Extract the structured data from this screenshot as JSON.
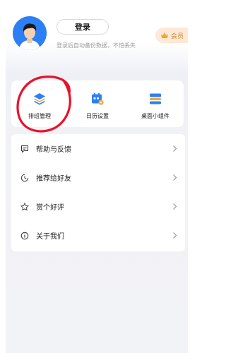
{
  "header": {
    "login_label": "登录",
    "login_hint": "登录后自动备份数据，不怕丢失",
    "vip_label": "会员"
  },
  "tools": [
    {
      "label": "排班管理",
      "icon": "layers-icon"
    },
    {
      "label": "日历设置",
      "icon": "calendar-settings-icon"
    },
    {
      "label": "桌面小组件",
      "icon": "widget-icon"
    }
  ],
  "menu": [
    {
      "label": "帮助与反馈",
      "icon": "feedback-icon"
    },
    {
      "label": "推荐给好友",
      "icon": "recommend-icon"
    },
    {
      "label": "赏个好评",
      "icon": "star-icon"
    },
    {
      "label": "关于我们",
      "icon": "info-icon"
    }
  ],
  "colors": {
    "accent_blue": "#2d7ff5",
    "vip_bg": "#ffe9d6",
    "vip_text": "#c98a3c",
    "annotation_red": "#e8122b"
  }
}
